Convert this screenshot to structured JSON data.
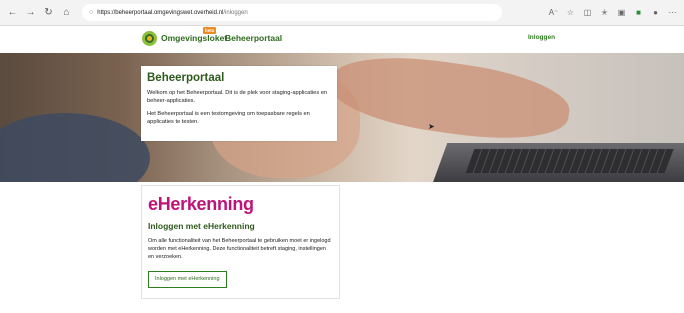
{
  "browser": {
    "url_host": "https://beheerportaal.omgevingswet.overheid.nl",
    "url_path": "/inloggen",
    "icons": [
      "back-icon",
      "forward-icon",
      "reload-icon",
      "home-icon",
      "lock-icon",
      "reader-icon",
      "favorite-icon",
      "split-icon",
      "favorites-icon",
      "collections-icon",
      "extension-icon",
      "profile-icon",
      "menu-icon"
    ]
  },
  "header": {
    "brand": "Omgevingsloket",
    "brand_badge": "beta",
    "portal_name": "Beheerportaal",
    "login_link": "Inloggen"
  },
  "hero": {
    "title": "Beheerportaal",
    "paragraph_1": "Welkom op het Beheerportaal. Dit is de plek voor staging-applicaties en beheer-applicaties.",
    "paragraph_2": "Het Beheerportaal is een testomgeving om toepasbare regels en applicaties te testen."
  },
  "eherkenning": {
    "logo_text": "eHerkenning",
    "title": "Inloggen met eHerkenning",
    "text": "Om alle functionaliteit van het Beheerportaal te gebruiken moet er ingelogd worden met eHerkenning. Deze functionaliteit betreft staging, instellingen en verzoeken.",
    "button": "Inloggen met eHerkenning"
  },
  "colors": {
    "brand_green": "#2e6b1f",
    "eherkenning_magenta": "#c0137a"
  }
}
